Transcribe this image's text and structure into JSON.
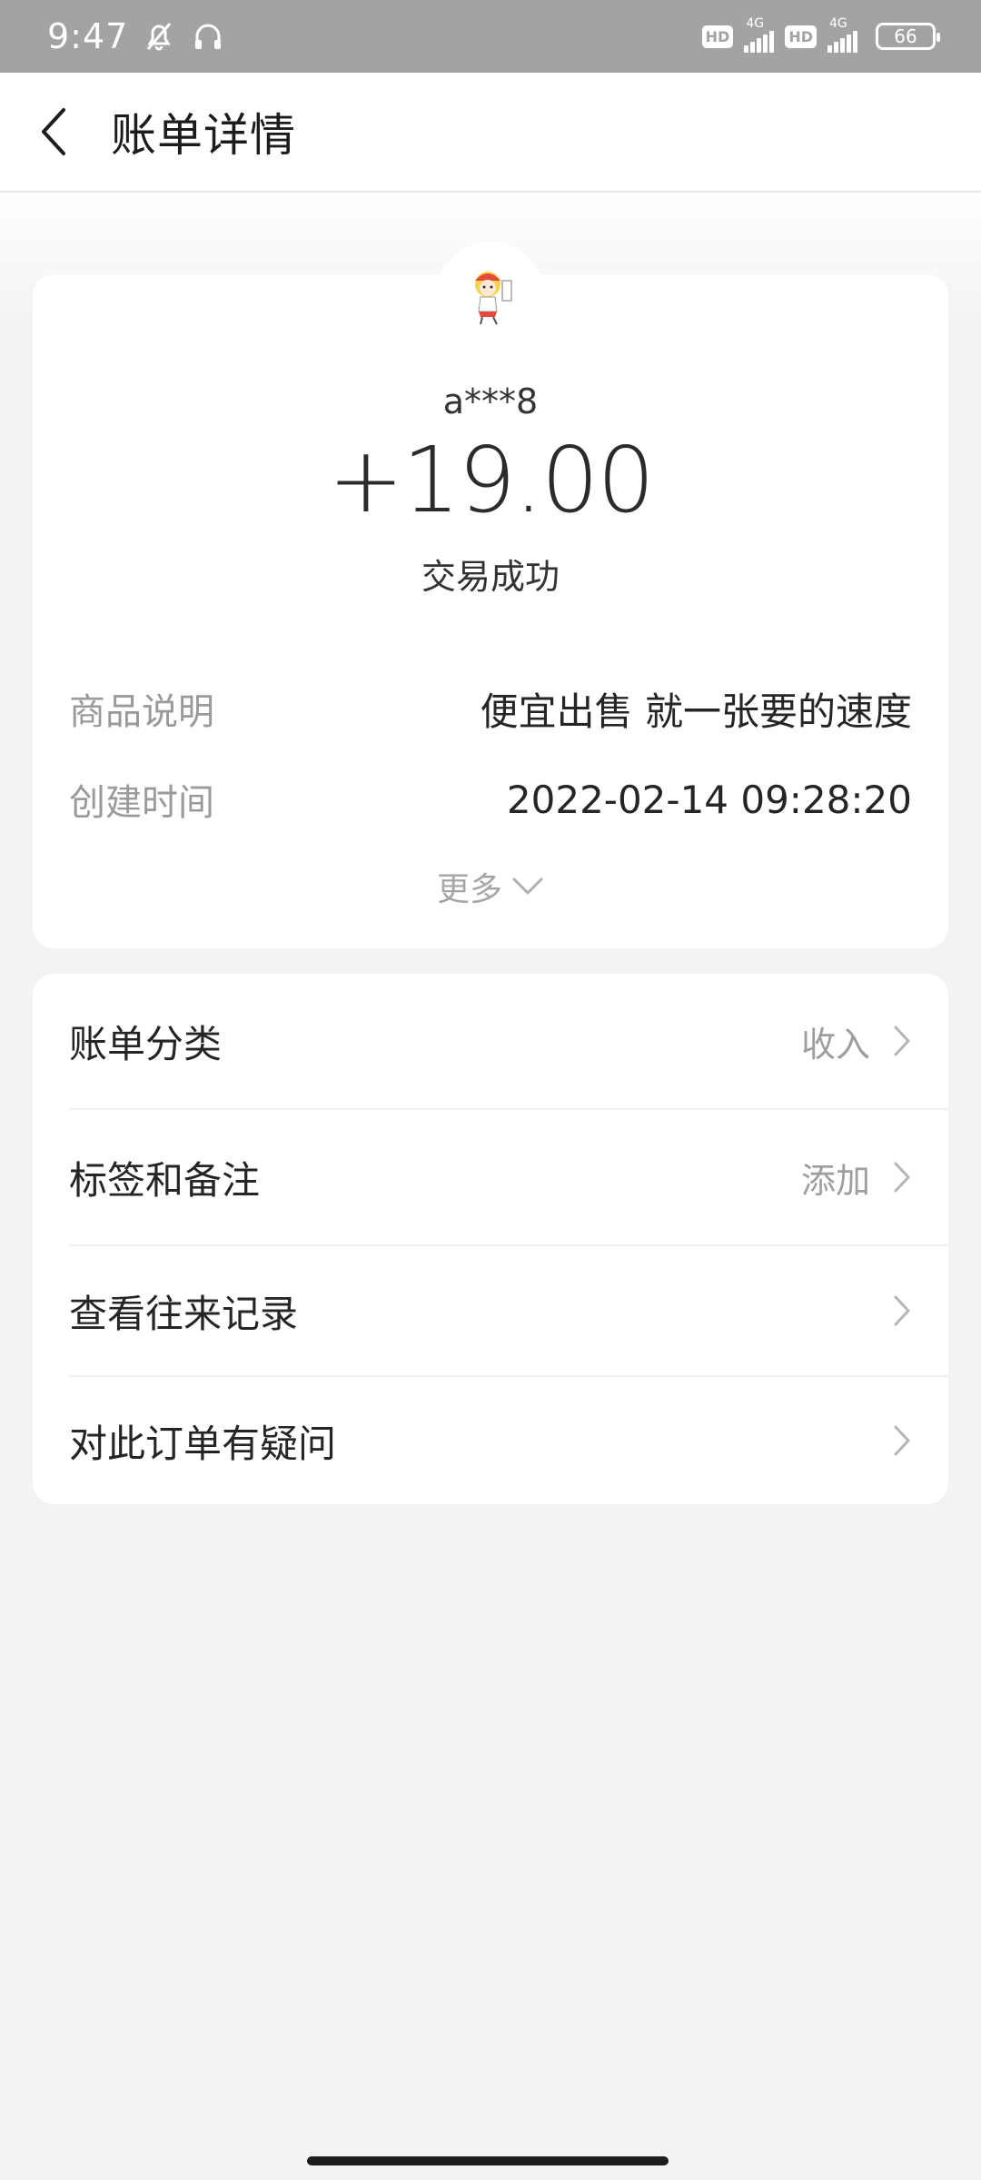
{
  "status_bar": {
    "time": "9:47",
    "battery": "66",
    "network": "4G",
    "hd": "HD"
  },
  "nav": {
    "title": "账单详情"
  },
  "detail": {
    "counterparty": "a***8",
    "amount": "+19.00",
    "status": "交易成功",
    "rows": [
      {
        "label": "商品说明",
        "value": "便宜出售 就一张要的速度"
      },
      {
        "label": "创建时间",
        "value": "2022-02-14  09:28:20"
      }
    ],
    "more_label": "更多"
  },
  "list": [
    {
      "label": "账单分类",
      "value": "收入"
    },
    {
      "label": "标签和备注",
      "value": "添加"
    },
    {
      "label": "查看往来记录",
      "value": ""
    },
    {
      "label": "对此订单有疑问",
      "value": ""
    }
  ]
}
